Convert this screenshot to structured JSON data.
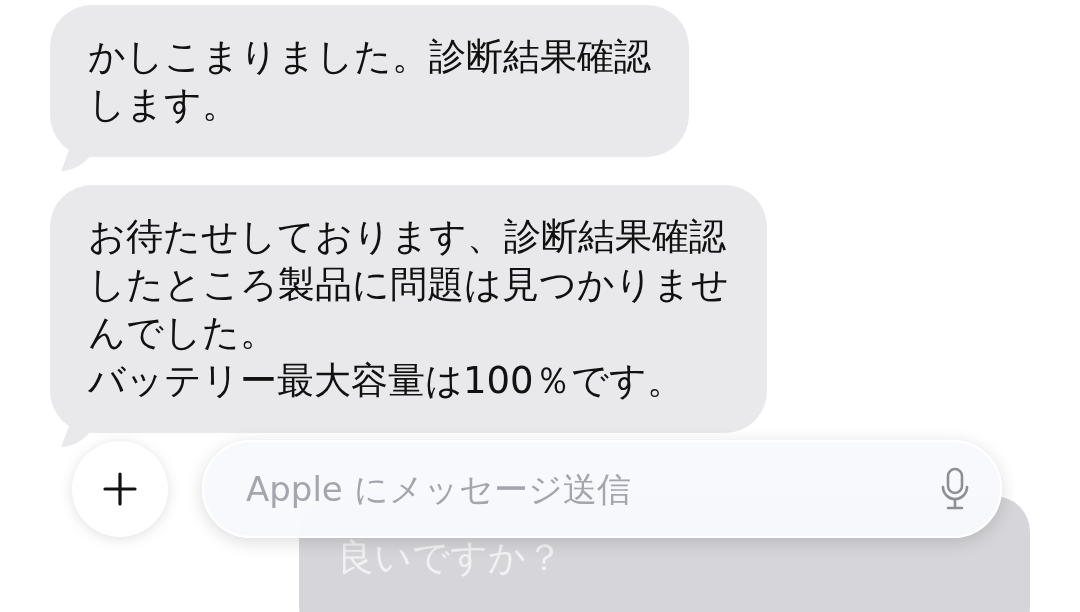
{
  "messages": [
    {
      "kind": "incoming",
      "lines": [
        "かしこまりました。診断結果確認",
        "します。"
      ]
    },
    {
      "kind": "incoming",
      "lines": [
        "お待たせしております、診断結果確認",
        "したところ製品に問題は見つかりませ",
        "んでした。",
        "バッテリー最大容量は100％です。"
      ]
    },
    {
      "kind": "outgoing",
      "lines": [
        "良いですか？"
      ]
    }
  ],
  "composer": {
    "placeholder": "Apple にメッセージ送信"
  }
}
